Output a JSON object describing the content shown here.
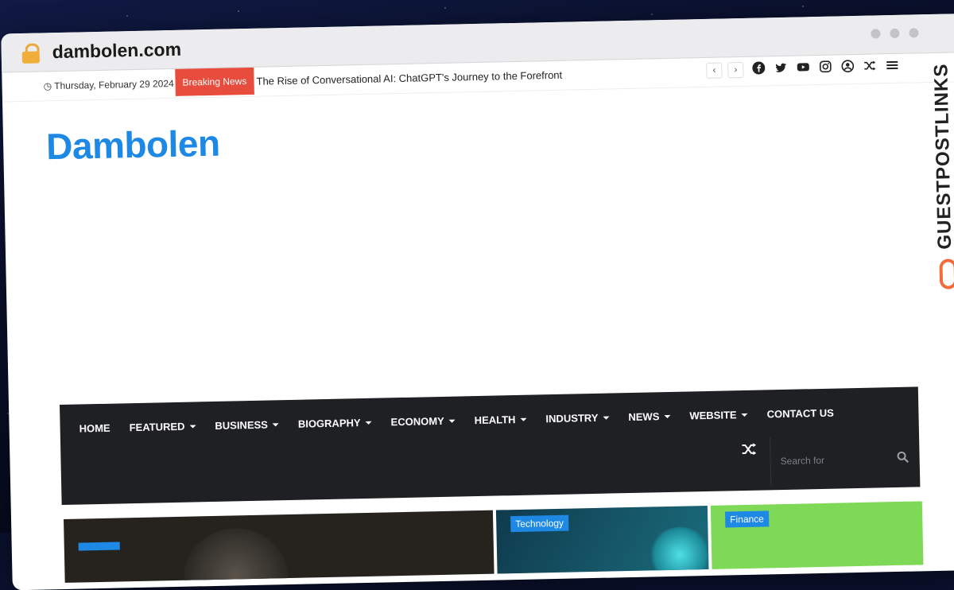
{
  "browser": {
    "url": "dambolen.com"
  },
  "topbar": {
    "date": "Thursday, February 29 2024",
    "breaking_label": "Breaking News",
    "ticker_text": "The Rise of Conversational AI: ChatGPT's Journey to the Forefront",
    "prev": "‹",
    "next": "›",
    "social_icons": [
      "facebook-icon",
      "twitter-icon",
      "youtube-icon",
      "instagram-icon",
      "user-icon",
      "shuffle-icon",
      "menu-icon"
    ]
  },
  "site": {
    "logo": "Dambolen"
  },
  "nav": {
    "items": [
      {
        "label": "HOME",
        "dropdown": false
      },
      {
        "label": "FEATURED",
        "dropdown": true
      },
      {
        "label": "BUSINESS",
        "dropdown": true
      },
      {
        "label": "BIOGRAPHY",
        "dropdown": true
      },
      {
        "label": "ECONOMY",
        "dropdown": true
      },
      {
        "label": "HEALTH",
        "dropdown": true
      },
      {
        "label": "INDUSTRY",
        "dropdown": true
      },
      {
        "label": "NEWS",
        "dropdown": true
      },
      {
        "label": "WEBSITE",
        "dropdown": true
      },
      {
        "label": "CONTACT US",
        "dropdown": false
      }
    ],
    "search_placeholder": "Search for"
  },
  "featured": {
    "cards": [
      {
        "category": ""
      },
      {
        "category": "Technology"
      },
      {
        "category": "Finance"
      }
    ]
  },
  "watermark": {
    "text": "GUESTPOSTLINKS"
  },
  "colors": {
    "accent": "#1e88e5",
    "breaking": "#e74c3c",
    "nav_bg": "#1f2024",
    "finance_card": "#7ed957"
  }
}
